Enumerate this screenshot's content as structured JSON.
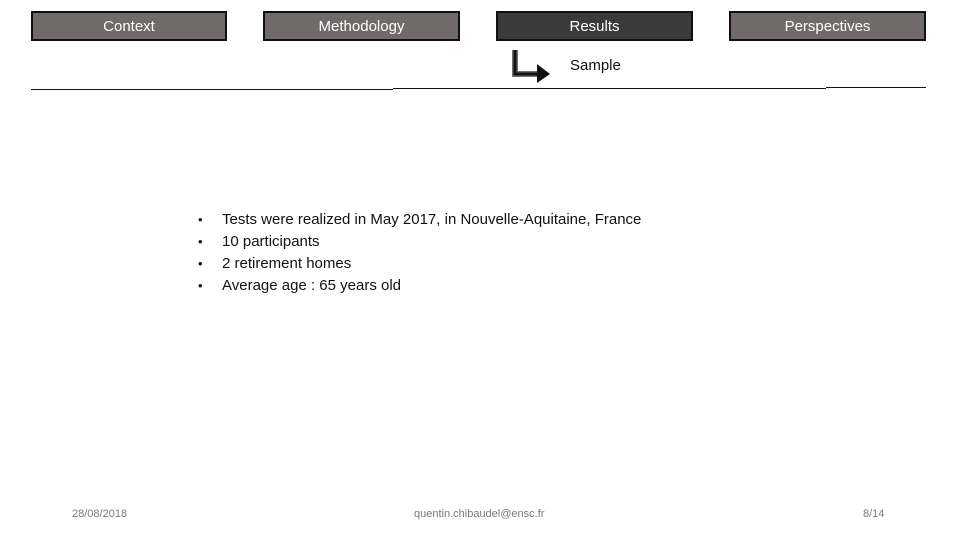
{
  "nav": {
    "tabs": [
      {
        "label": "Context",
        "active": false
      },
      {
        "label": "Methodology",
        "active": false
      },
      {
        "label": "Results",
        "active": true
      },
      {
        "label": "Perspectives",
        "active": false
      }
    ],
    "subsection": "Sample",
    "subsection_icon": "arrow-down-right-icon"
  },
  "content": {
    "bullet_glyph": "•",
    "bullets": [
      "Tests were realized in May 2017, in Nouvelle-Aquitaine, France",
      "10 participants",
      "2 retirement homes",
      "Average age : 65 years old"
    ]
  },
  "footer": {
    "date": "28/08/2018",
    "email": "quentin.chibaudel@ensc.fr",
    "page": "8/14"
  },
  "colors": {
    "tab_bg": "#706b6a",
    "tab_active_bg": "#3a3a3a",
    "tab_border": "#111111"
  }
}
